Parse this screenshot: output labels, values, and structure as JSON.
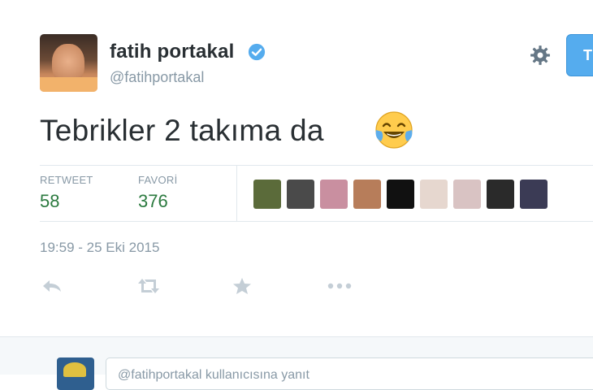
{
  "author": {
    "name": "fatih portakal",
    "handle": "@fatihportakal",
    "verified": true
  },
  "follow_button": {
    "label": "T"
  },
  "tweet": {
    "text": "Tebrikler 2 takıma da",
    "emoji": "face-with-tears-of-joy"
  },
  "stats": {
    "retweets_label": "RETWEET",
    "retweets_value": "58",
    "favorites_label": "FAVORİ",
    "favorites_value": "376"
  },
  "favoriters": [
    {
      "color": "#5b6b3a"
    },
    {
      "color": "#4a4a4a"
    },
    {
      "color": "#c98fa0"
    },
    {
      "color": "#b77d5a"
    },
    {
      "color": "#111111"
    },
    {
      "color": "#e6d7cf"
    },
    {
      "color": "#d9c3c3"
    },
    {
      "color": "#2a2a2a"
    },
    {
      "color": "#3b3b55"
    }
  ],
  "timestamp": "19:59 - 25 Eki 2015",
  "actions": [
    "reply-icon",
    "retweet-icon",
    "favorite-icon",
    "more-icon"
  ],
  "reply": {
    "placeholder": "@fatihportakal kullanıcısına yanıt"
  },
  "colors": {
    "accent": "#55acee",
    "stat_value": "#2b7a3f",
    "muted": "#8899a6",
    "text": "#292f33"
  }
}
